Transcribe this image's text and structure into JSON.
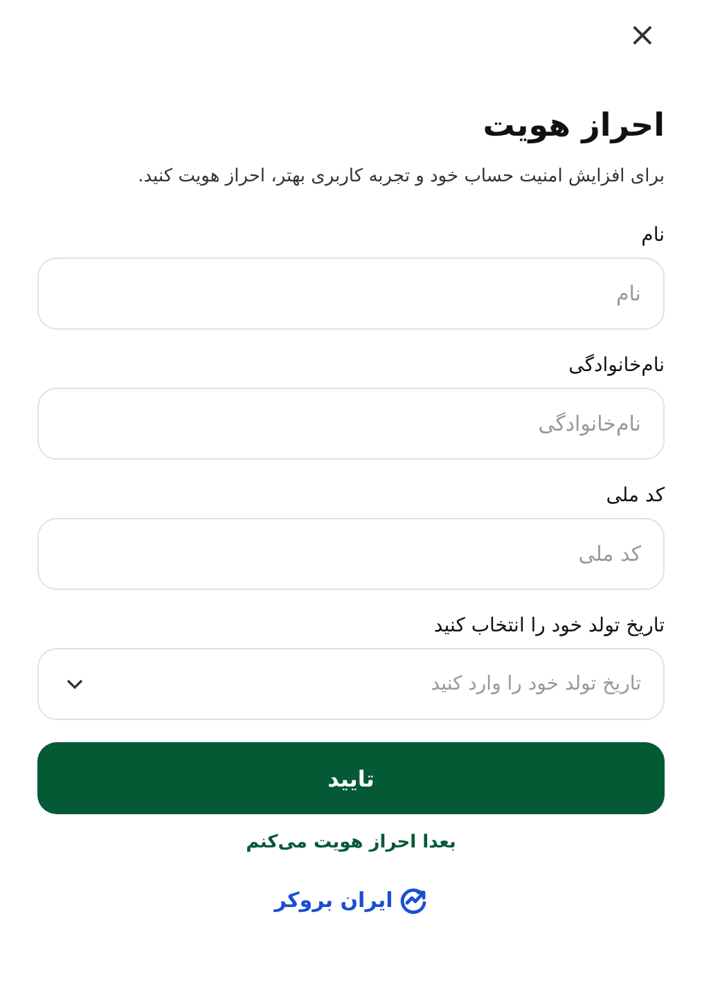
{
  "dialog": {
    "close": "×",
    "title": "احراز هویت",
    "subtitle": "برای افزایش امنیت حساب خود و تجربه کاربری بهتر، احراز هویت کنید."
  },
  "fields": [
    {
      "kind": "text",
      "label": "نام",
      "placeholder": "نام"
    },
    {
      "kind": "text",
      "label": "نام‌خانوادگی",
      "placeholder": "نام‌خانوادگی"
    },
    {
      "kind": "text",
      "label": "کد ملی",
      "placeholder": "کد ملی"
    },
    {
      "kind": "select",
      "label": "تاریخ تولد خود را انتخاب کنید",
      "placeholder": "تاریخ تولد خود را وارد کنید"
    }
  ],
  "submit": "تایید",
  "later_link": "بعدا احراز هویت می‌کنم",
  "logo": "ایران بروکر"
}
